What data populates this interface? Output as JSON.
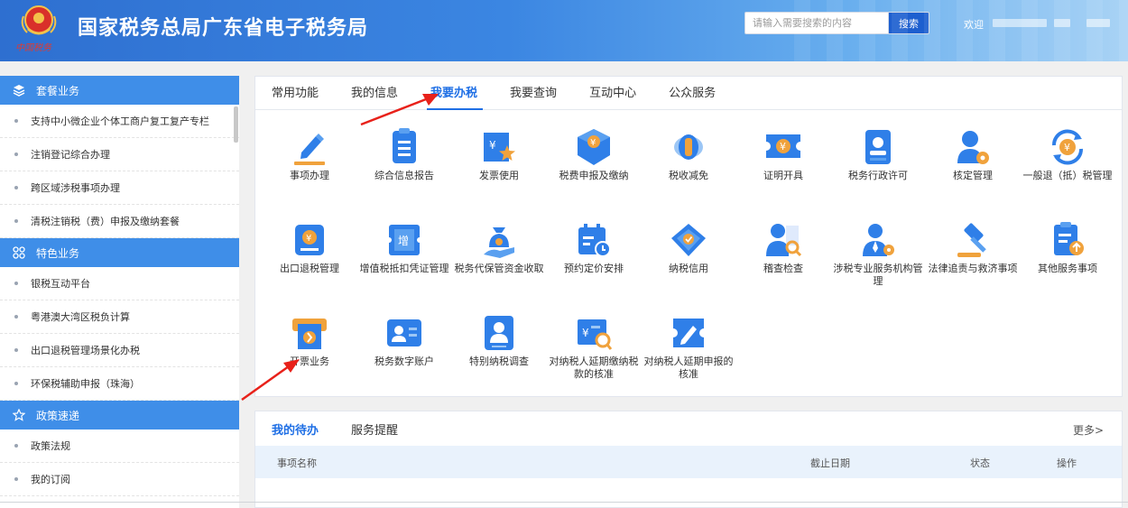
{
  "header": {
    "title": "国家税务总局广东省电子税务局",
    "emblem_text": "中国税务",
    "search_placeholder": "请输入需要搜索的内容",
    "search_button": "搜索",
    "welcome": "欢迎"
  },
  "sidebar": {
    "sections": [
      {
        "title": "套餐业务",
        "icon": "layers-icon",
        "items": [
          "支持中小微企业个体工商户复工复产专栏",
          "注销登记综合办理",
          "跨区域涉税事项办理",
          "清税注销税（费）申报及缴纳套餐"
        ]
      },
      {
        "title": "特色业务",
        "icon": "grid-icon",
        "items": [
          "银税互动平台",
          "粤港澳大湾区税负计算",
          "出口退税管理场景化办税",
          "环保税辅助申报（珠海）"
        ]
      },
      {
        "title": "政策速递",
        "icon": "star-icon",
        "items": [
          "政策法规",
          "我的订阅"
        ]
      }
    ]
  },
  "main": {
    "tabs": [
      "常用功能",
      "我的信息",
      "我要办税",
      "我要查询",
      "互动中心",
      "公众服务"
    ],
    "active_tab": "我要办税",
    "functions": [
      {
        "label": "事项办理",
        "icon": "pencil-icon"
      },
      {
        "label": "综合信息报告",
        "icon": "document-list-icon"
      },
      {
        "label": "发票使用",
        "icon": "invoice-star-icon"
      },
      {
        "label": "税费申报及缴纳",
        "icon": "tax-box-icon"
      },
      {
        "label": "税收减免",
        "icon": "coin-stack-icon"
      },
      {
        "label": "证明开具",
        "icon": "certificate-icon"
      },
      {
        "label": "税务行政许可",
        "icon": "id-card-icon"
      },
      {
        "label": "核定管理",
        "icon": "user-gear-icon"
      },
      {
        "label": "一般退（抵）税管理",
        "icon": "refund-cycle-icon"
      },
      {
        "label": "出口退税管理",
        "icon": "export-refund-icon"
      },
      {
        "label": "增值税抵扣凭证管理",
        "icon": "vat-ticket-icon"
      },
      {
        "label": "税务代保管资金收取",
        "icon": "money-bag-icon"
      },
      {
        "label": "预约定价安排",
        "icon": "calendar-clock-icon"
      },
      {
        "label": "纳税信用",
        "icon": "diamond-check-icon"
      },
      {
        "label": "稽查检查",
        "icon": "inspect-user-icon"
      },
      {
        "label": "涉税专业服务机构管理",
        "icon": "agency-user-icon"
      },
      {
        "label": "法律追责与救济事项",
        "icon": "gavel-icon"
      },
      {
        "label": "其他服务事项",
        "icon": "clipboard-upload-icon"
      },
      {
        "label": "开票业务",
        "icon": "invoice-print-icon"
      },
      {
        "label": "税务数字账户",
        "icon": "digital-account-icon"
      },
      {
        "label": "特别纳税调查",
        "icon": "special-user-icon"
      },
      {
        "label": "对纳税人延期缴纳税款的核准",
        "icon": "ticket-search-icon"
      },
      {
        "label": "对纳税人延期申报的核准",
        "icon": "edit-ticket-icon"
      }
    ]
  },
  "todo": {
    "tabs": [
      "我的待办",
      "服务提醒"
    ],
    "more": "更多>",
    "columns": [
      "事项名称",
      "截止日期",
      "状态",
      "操作"
    ]
  },
  "colors": {
    "header_start": "#2e6fd0",
    "header_end": "#a9d3f5",
    "sidebar_section": "#3f8ee8",
    "active_tab": "#1f6fe5",
    "icon_blue": "#2f7fe8",
    "icon_orange": "#f0a23c",
    "arrow_red": "#e8211a"
  }
}
